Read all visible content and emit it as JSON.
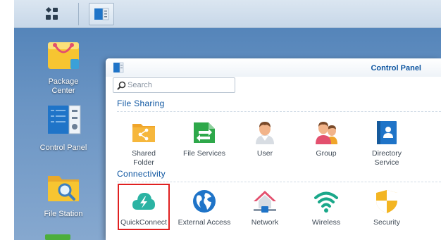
{
  "taskbar": {
    "main_menu_icon": "grid-icon",
    "active_app_icon": "control-panel-icon"
  },
  "desktop": {
    "icons": [
      {
        "label": "Package Center",
        "icon": "package-center-icon"
      },
      {
        "label": "Control Panel",
        "icon": "control-panel-icon"
      },
      {
        "label": "File Station",
        "icon": "file-station-icon"
      }
    ]
  },
  "window": {
    "title": "Control Panel",
    "search": {
      "placeholder": "Search",
      "value": ""
    },
    "sections": [
      {
        "title": "File Sharing",
        "items": [
          {
            "label": "Shared Folder",
            "icon": "shared-folder-icon"
          },
          {
            "label": "File Services",
            "icon": "file-services-icon"
          },
          {
            "label": "User",
            "icon": "user-icon"
          },
          {
            "label": "Group",
            "icon": "group-icon"
          },
          {
            "label": "Directory Service",
            "icon": "directory-service-icon"
          }
        ]
      },
      {
        "title": "Connectivity",
        "items": [
          {
            "label": "QuickConnect",
            "icon": "quickconnect-icon",
            "highlighted": true
          },
          {
            "label": "External Access",
            "icon": "external-access-icon"
          },
          {
            "label": "Network",
            "icon": "network-icon"
          },
          {
            "label": "Wireless",
            "icon": "wireless-icon"
          },
          {
            "label": "Security",
            "icon": "security-icon"
          }
        ]
      }
    ]
  },
  "colors": {
    "accent": "#0d55a0",
    "highlight_border": "#e02020",
    "shared_folder": "#f0a52a",
    "file_services": "#2ea84a",
    "quickconnect": "#2bb3a3",
    "external_access": "#1f74c8",
    "wireless": "#1aa88a",
    "security": "#f3b522"
  }
}
